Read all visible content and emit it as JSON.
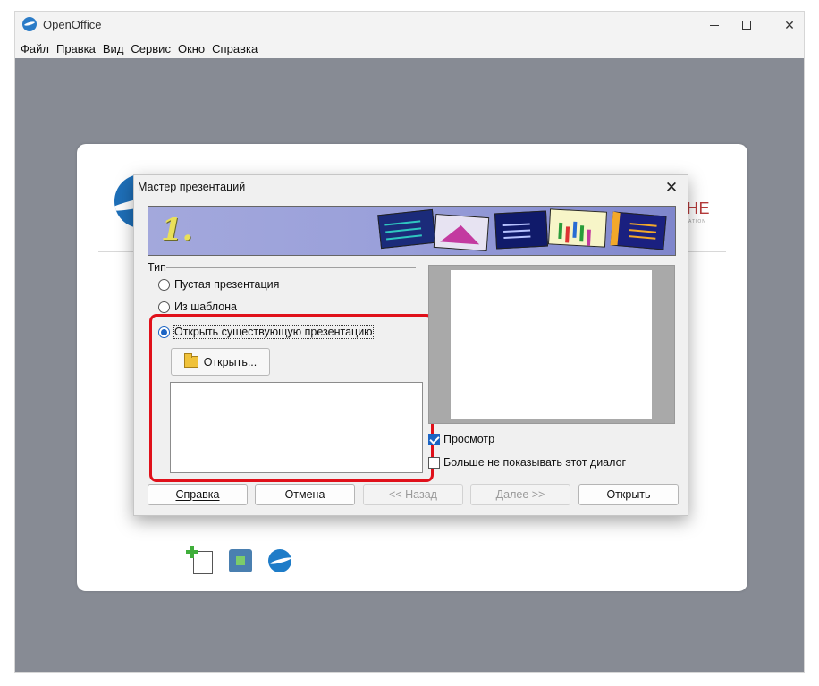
{
  "window": {
    "title": "OpenOffice",
    "controls": {
      "minimize": "",
      "maximize": "",
      "close": "✕"
    }
  },
  "menubar": {
    "items": [
      "Файл",
      "Правка",
      "Вид",
      "Сервис",
      "Окно",
      "Справка"
    ]
  },
  "start_center": {
    "brand_text": "HE",
    "brand_subtext": "ATION"
  },
  "dialog": {
    "title": "Мастер презентаций",
    "close": "✕",
    "step_number": "1.",
    "type_group_label": "Тип",
    "options": [
      {
        "label": "Пустая презентация",
        "checked": false
      },
      {
        "label": "Из шаблона",
        "checked": false
      },
      {
        "label": "Открыть существующую презентацию",
        "checked": true
      }
    ],
    "open_button": "Открыть...",
    "preview_checkbox": {
      "label": "Просмотр",
      "checked": true
    },
    "dont_show_checkbox": {
      "label": "Больше не показывать этот диалог",
      "checked": false
    },
    "buttons": {
      "help": "Справка",
      "cancel": "Отмена",
      "back": "<< Назад",
      "next": "Далее >>",
      "open": "Открыть"
    }
  },
  "colors": {
    "highlight": "#e0101a",
    "accent": "#1b64c4",
    "workspace": "#878b94"
  }
}
